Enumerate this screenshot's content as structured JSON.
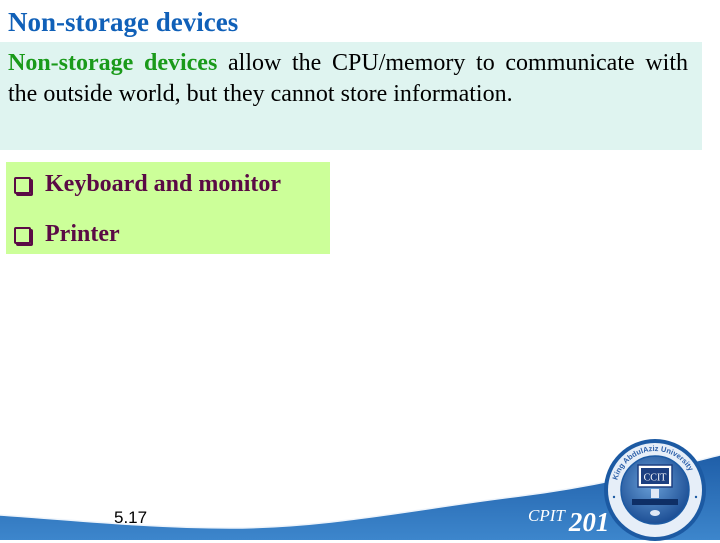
{
  "slide": {
    "title": "Non-storage devices",
    "definition": {
      "highlight": "Non-storage devices",
      "text": " allow the CPU/memory to communicate with the outside world, but they cannot store information."
    },
    "bullets": [
      {
        "icon": "checkbox-bullet-icon",
        "label": "Keyboard and monitor"
      },
      {
        "icon": "checkbox-bullet-icon",
        "label": "Printer"
      }
    ],
    "page_number": "5.17",
    "course": {
      "prefix": "CPIT",
      "number": "201"
    },
    "logo": {
      "label": "CCIT",
      "ring_text": "King AbdulAziz University"
    }
  },
  "colors": {
    "title": "#1060b8",
    "highlight": "#1a9a1a",
    "definition_bg": "#dff4f0",
    "list_bg": "#ccff99",
    "list_text": "#5a0a45",
    "swoosh": "#2e6db4"
  }
}
